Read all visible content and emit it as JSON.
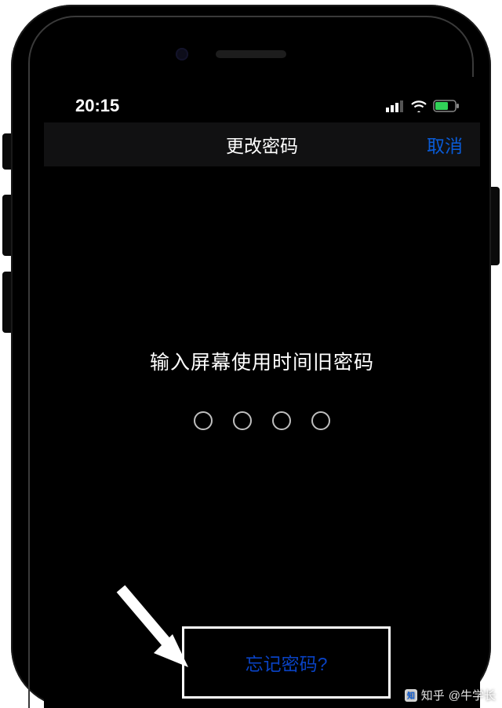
{
  "status": {
    "time": "20:15"
  },
  "nav": {
    "title": "更改密码",
    "cancel": "取消"
  },
  "content": {
    "prompt": "输入屏幕使用时间旧密码",
    "forgot": "忘记密码?"
  },
  "watermark": {
    "site": "知乎",
    "author": "@牛学长"
  }
}
